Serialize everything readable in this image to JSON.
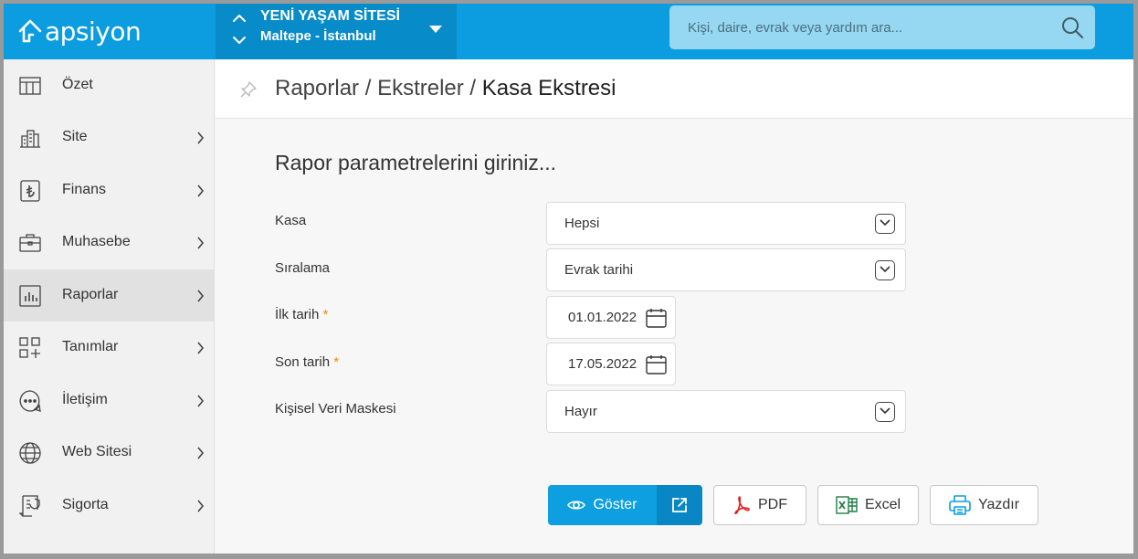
{
  "app": {
    "logo_text": "apsiyon"
  },
  "site": {
    "name": "YENİ YAŞAM SİTESİ",
    "location": "Maltepe - İstanbul"
  },
  "search": {
    "placeholder": "Kişi, daire, evrak veya yardım ara..."
  },
  "sidebar": {
    "items": [
      {
        "label": "Özet",
        "icon": "table-icon",
        "has_chevron": false
      },
      {
        "label": "Site",
        "icon": "buildings-icon",
        "has_chevron": true
      },
      {
        "label": "Finans",
        "icon": "lira-icon",
        "has_chevron": true
      },
      {
        "label": "Muhasebe",
        "icon": "briefcase-icon",
        "has_chevron": true
      },
      {
        "label": "Raporlar",
        "icon": "bar-chart-icon",
        "has_chevron": true,
        "active": true
      },
      {
        "label": "Tanımlar",
        "icon": "grid-plus-icon",
        "has_chevron": true
      },
      {
        "label": "İletişim",
        "icon": "chat-bubble-icon",
        "has_chevron": true
      },
      {
        "label": "Web Sitesi",
        "icon": "globe-icon",
        "has_chevron": true
      },
      {
        "label": "Sigorta",
        "icon": "insurance-doc-icon",
        "has_chevron": true
      }
    ]
  },
  "breadcrumb": {
    "part1": "Raporlar",
    "sep": "/",
    "part2": "Ekstreler",
    "current": "Kasa Ekstresi"
  },
  "form": {
    "title": "Rapor parametrelerini giriniz...",
    "required_mark": "*",
    "fields": [
      {
        "label": "Kasa",
        "value": "Hepsi",
        "type": "select"
      },
      {
        "label": "Sıralama",
        "value": "Evrak tarihi",
        "type": "select"
      },
      {
        "label": "İlk tarih",
        "value": "01.01.2022",
        "type": "date",
        "required": true
      },
      {
        "label": "Son tarih",
        "value": "17.05.2022",
        "type": "date",
        "required": true
      },
      {
        "label": "Kişisel Veri Maskesi",
        "value": "Hayır",
        "type": "select"
      }
    ]
  },
  "actions": {
    "show": "Göster",
    "pdf": "PDF",
    "excel": "Excel",
    "print": "Yazdır"
  },
  "colors": {
    "brand": "#0b9de0",
    "brand_dark": "#088bc9",
    "required": "#f08c00",
    "pdf_red": "#e02020",
    "excel_green": "#1e7d45"
  }
}
